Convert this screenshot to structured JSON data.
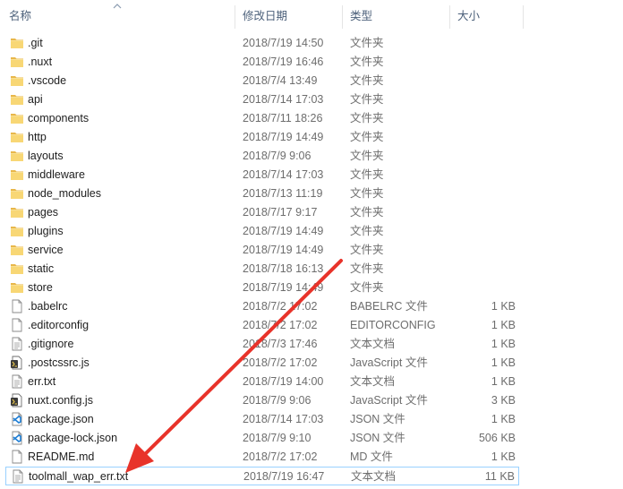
{
  "columns": {
    "name": "名称",
    "date": "修改日期",
    "type": "类型",
    "size": "大小"
  },
  "sort_icon": "sort-up-arrow-icon",
  "files": [
    {
      "name": ".git",
      "date": "2018/7/19 14:50",
      "type": "文件夹",
      "size": "",
      "icon": "folder-icon"
    },
    {
      "name": ".nuxt",
      "date": "2018/7/19 16:46",
      "type": "文件夹",
      "size": "",
      "icon": "folder-icon"
    },
    {
      "name": ".vscode",
      "date": "2018/7/4 13:49",
      "type": "文件夹",
      "size": "",
      "icon": "folder-icon"
    },
    {
      "name": "api",
      "date": "2018/7/14 17:03",
      "type": "文件夹",
      "size": "",
      "icon": "folder-icon"
    },
    {
      "name": "components",
      "date": "2018/7/11 18:26",
      "type": "文件夹",
      "size": "",
      "icon": "folder-icon"
    },
    {
      "name": "http",
      "date": "2018/7/19 14:49",
      "type": "文件夹",
      "size": "",
      "icon": "folder-icon"
    },
    {
      "name": "layouts",
      "date": "2018/7/9 9:06",
      "type": "文件夹",
      "size": "",
      "icon": "folder-icon"
    },
    {
      "name": "middleware",
      "date": "2018/7/14 17:03",
      "type": "文件夹",
      "size": "",
      "icon": "folder-icon"
    },
    {
      "name": "node_modules",
      "date": "2018/7/13 11:19",
      "type": "文件夹",
      "size": "",
      "icon": "folder-icon"
    },
    {
      "name": "pages",
      "date": "2018/7/17 9:17",
      "type": "文件夹",
      "size": "",
      "icon": "folder-icon"
    },
    {
      "name": "plugins",
      "date": "2018/7/19 14:49",
      "type": "文件夹",
      "size": "",
      "icon": "folder-icon"
    },
    {
      "name": "service",
      "date": "2018/7/19 14:49",
      "type": "文件夹",
      "size": "",
      "icon": "folder-icon"
    },
    {
      "name": "static",
      "date": "2018/7/18 16:13",
      "type": "文件夹",
      "size": "",
      "icon": "folder-icon"
    },
    {
      "name": "store",
      "date": "2018/7/19 14:49",
      "type": "文件夹",
      "size": "",
      "icon": "folder-icon"
    },
    {
      "name": ".babelrc",
      "date": "2018/7/2 17:02",
      "type": "BABELRC 文件",
      "size": "1 KB",
      "icon": "file-icon"
    },
    {
      "name": ".editorconfig",
      "date": "2018/7/2 17:02",
      "type": "EDITORCONFIG",
      "size": "1 KB",
      "icon": "file-icon"
    },
    {
      "name": ".gitignore",
      "date": "2018/7/3 17:46",
      "type": "文本文档",
      "size": "1 KB",
      "icon": "text-file-icon"
    },
    {
      "name": ".postcssrc.js",
      "date": "2018/7/2 17:02",
      "type": "JavaScript 文件",
      "size": "1 KB",
      "icon": "script-file-icon"
    },
    {
      "name": "err.txt",
      "date": "2018/7/19 14:00",
      "type": "文本文档",
      "size": "1 KB",
      "icon": "text-file-icon"
    },
    {
      "name": "nuxt.config.js",
      "date": "2018/7/9 9:06",
      "type": "JavaScript 文件",
      "size": "3 KB",
      "icon": "script-file-icon"
    },
    {
      "name": "package.json",
      "date": "2018/7/14 17:03",
      "type": "JSON 文件",
      "size": "1 KB",
      "icon": "vscode-file-icon"
    },
    {
      "name": "package-lock.json",
      "date": "2018/7/9 9:10",
      "type": "JSON 文件",
      "size": "506 KB",
      "icon": "vscode-file-icon"
    },
    {
      "name": "README.md",
      "date": "2018/7/2 17:02",
      "type": "MD 文件",
      "size": "1 KB",
      "icon": "file-icon"
    },
    {
      "name": "toolmall_wap_err.txt",
      "date": "2018/7/19 16:47",
      "type": "文本文档",
      "size": "11 KB",
      "icon": "text-file-icon",
      "selected": true
    }
  ],
  "annotation": {
    "color": "#e8332a",
    "icon": "red-arrow-annotation"
  }
}
